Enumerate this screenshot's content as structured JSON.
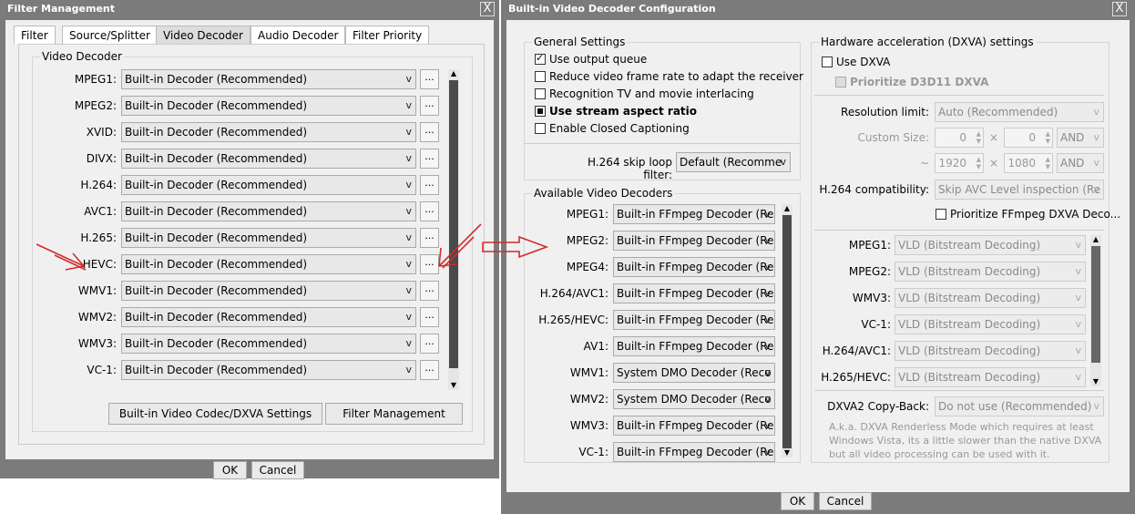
{
  "left": {
    "title": "Filter Management",
    "close": "X",
    "tabs": [
      "Filter",
      "Source/Splitter",
      "Video Decoder",
      "Audio Decoder",
      "Filter Priority"
    ],
    "group_title": "Video Decoder",
    "rows": [
      {
        "label": "MPEG1:",
        "value": "Built-in Decoder (Recommended)"
      },
      {
        "label": "MPEG2:",
        "value": "Built-in Decoder (Recommended)"
      },
      {
        "label": "XVID:",
        "value": "Built-in Decoder (Recommended)"
      },
      {
        "label": "DIVX:",
        "value": "Built-in Decoder (Recommended)"
      },
      {
        "label": "H.264:",
        "value": "Built-in Decoder (Recommended)"
      },
      {
        "label": "AVC1:",
        "value": "Built-in Decoder (Recommended)"
      },
      {
        "label": "H.265:",
        "value": "Built-in Decoder (Recommended)"
      },
      {
        "label": "HEVC:",
        "value": "Built-in Decoder (Recommended)"
      },
      {
        "label": "WMV1:",
        "value": "Built-in Decoder (Recommended)"
      },
      {
        "label": "WMV2:",
        "value": "Built-in Decoder (Recommended)"
      },
      {
        "label": "WMV3:",
        "value": "Built-in Decoder (Recommended)"
      },
      {
        "label": "VC-1:",
        "value": "Built-in Decoder (Recommended)"
      }
    ],
    "combo_arrow": "v",
    "dots": "...",
    "buttons": {
      "codec_settings": "Built-in Video Codec/DXVA Settings",
      "filter_management": "Filter Management"
    },
    "ok": "OK",
    "cancel": "Cancel"
  },
  "right": {
    "title": "Built-in Video Decoder Configuration",
    "close": "X",
    "general": {
      "title": "General Settings",
      "options": [
        {
          "label": "Use output queue",
          "state": "checked"
        },
        {
          "label": "Reduce video frame rate to adapt the receiver",
          "state": "unchecked"
        },
        {
          "label": "Recognition TV and movie interlacing",
          "state": "unchecked"
        },
        {
          "label": "Use stream aspect ratio",
          "state": "filled"
        },
        {
          "label": "Enable Closed Captioning",
          "state": "unchecked"
        }
      ],
      "skip_label": "H.264 skip loop filter:",
      "skip_value": "Default (Recomme"
    },
    "decoders": {
      "title": "Available Video Decoders",
      "rows": [
        {
          "label": "MPEG1:",
          "value": "Built-in FFmpeg Decoder (Re"
        },
        {
          "label": "MPEG2:",
          "value": "Built-in FFmpeg Decoder (Re"
        },
        {
          "label": "MPEG4:",
          "value": "Built-in FFmpeg Decoder (Re"
        },
        {
          "label": "H.264/AVC1:",
          "value": "Built-in FFmpeg Decoder (Re"
        },
        {
          "label": "H.265/HEVC:",
          "value": "Built-in FFmpeg Decoder (Re"
        },
        {
          "label": "AV1:",
          "value": "Built-in FFmpeg Decoder (Re"
        },
        {
          "label": "WMV1:",
          "value": "System DMO Decoder (Reco"
        },
        {
          "label": "WMV2:",
          "value": "System DMO Decoder (Reco"
        },
        {
          "label": "WMV3:",
          "value": "Built-in FFmpeg Decoder (Re"
        },
        {
          "label": "VC-1:",
          "value": "Built-in FFmpeg Decoder (Re"
        }
      ]
    },
    "dxva": {
      "title": "Hardware acceleration (DXVA) settings",
      "use_dxva": "Use DXVA",
      "prioritize_d3d11": "Prioritize D3D11 DXVA",
      "resolution_label": "Resolution limit:",
      "resolution_value": "Auto (Recommended)",
      "custom_size_label": "Custom Size:",
      "custom_w": "0",
      "custom_h": "0",
      "x_sign": "×",
      "and1": "AND",
      "tilde": "~",
      "max_w": "1920",
      "max_h": "1080",
      "and2": "AND",
      "compat_label": "H.264 compatibility:",
      "compat_value": "Skip AVC Level inspection (Re",
      "prioritize_ffmpeg": "Prioritize FFmpeg DXVA Deco...",
      "rows": [
        {
          "label": "MPEG1:",
          "value": "VLD (Bitstream Decoding)"
        },
        {
          "label": "MPEG2:",
          "value": "VLD (Bitstream Decoding)"
        },
        {
          "label": "WMV3:",
          "value": "VLD (Bitstream Decoding)"
        },
        {
          "label": "VC-1:",
          "value": "VLD (Bitstream Decoding)"
        },
        {
          "label": "H.264/AVC1:",
          "value": "VLD (Bitstream Decoding)"
        },
        {
          "label": "H.265/HEVC:",
          "value": "VLD (Bitstream Decoding)"
        }
      ],
      "copyback_label": "DXVA2 Copy-Back:",
      "copyback_value": "Do not use (Recommended)",
      "note": "A.k.a. DXVA Renderless Mode which requires at least Windows Vista, its a little slower than the native DXVA but all video processing can be used with it."
    },
    "ok": "OK",
    "cancel": "Cancel"
  },
  "annotations": {
    "color": "#d42a2a",
    "arrow_glyph": "⇒"
  }
}
